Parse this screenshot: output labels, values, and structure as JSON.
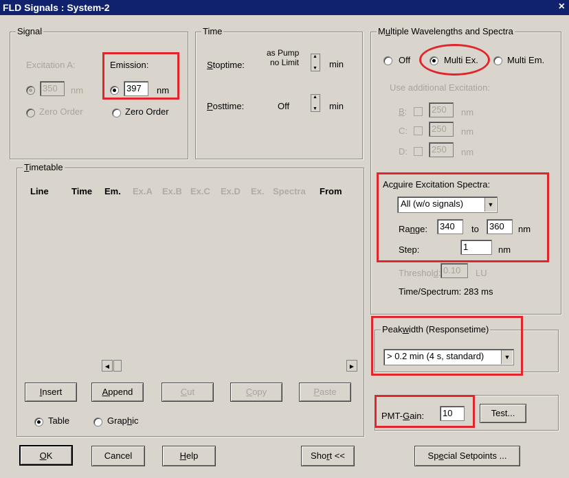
{
  "window": {
    "title": "FLD Signals : System-2",
    "close": "×"
  },
  "signal": {
    "legend": "Signal",
    "excitation_label": "Excitation A:",
    "excitation_value": "350",
    "excitation_unit": "nm",
    "excitation_zero": "Zero Order",
    "emission_label": "Emission:",
    "emission_value": "397",
    "emission_unit": "nm",
    "emission_zero": "Zero Order"
  },
  "time": {
    "legend": "Time",
    "stoptime_label": "Stoptime:",
    "stoptime_value_1": "as Pump",
    "stoptime_value_2": "no Limit",
    "stoptime_unit": "min",
    "posttime_label": "Posttime:",
    "posttime_value": "Off",
    "posttime_unit": "min"
  },
  "multi": {
    "legend": "Multiple Wavelengths and Spectra",
    "off": "Off",
    "multi_ex": "Multi Ex.",
    "multi_em": "Multi Em.",
    "use_additional": "Use additional Excitation:",
    "b_label": "B:",
    "b_value": "250",
    "b_unit": "nm",
    "c_label": "C:",
    "c_value": "250",
    "c_unit": "nm",
    "d_label": "D:",
    "d_value": "250",
    "d_unit": "nm",
    "acquire_label": "Acquire Excitation Spectra:",
    "acquire_value": "All (w/o signals)",
    "range_label": "Range:",
    "range_from": "340",
    "range_to_label": "to",
    "range_to": "360",
    "range_unit": "nm",
    "step_label": "Step:",
    "step_value": "1",
    "step_unit": "nm",
    "threshold_label": "Threshold:",
    "threshold_value": "0.10",
    "threshold_unit": "LU",
    "time_spectrum": "Time/Spectrum: 283 ms"
  },
  "peakwidth": {
    "legend": "Peakwidth (Responsetime)",
    "value": "> 0.2 min  (4 s, standard)"
  },
  "pmt": {
    "label": "PMT-Gain:",
    "value": "10",
    "test": "Test..."
  },
  "timetable": {
    "legend": "Timetable",
    "columns": [
      "Line",
      "Time",
      "Em.",
      "Ex.A",
      "Ex.B",
      "Ex.C",
      "Ex.D",
      "Ex.",
      "Spectra",
      "From"
    ],
    "insert": "Insert",
    "append": "Append",
    "cut": "Cut",
    "copy": "Copy",
    "paste": "Paste",
    "table": "Table",
    "graphic": "Graphic"
  },
  "footer": {
    "ok": "OK",
    "cancel": "Cancel",
    "help": "Help",
    "short": "Short <<",
    "special": "Special Setpoints ..."
  },
  "colors": {
    "titlebar": "#10226e",
    "dialog": "#dad5cc",
    "highlight": "#e0262c"
  },
  "icons": [
    "close-icon",
    "spin-icon",
    "dropdown-arrow-icon",
    "scroll-left-icon",
    "scroll-right-icon"
  ]
}
